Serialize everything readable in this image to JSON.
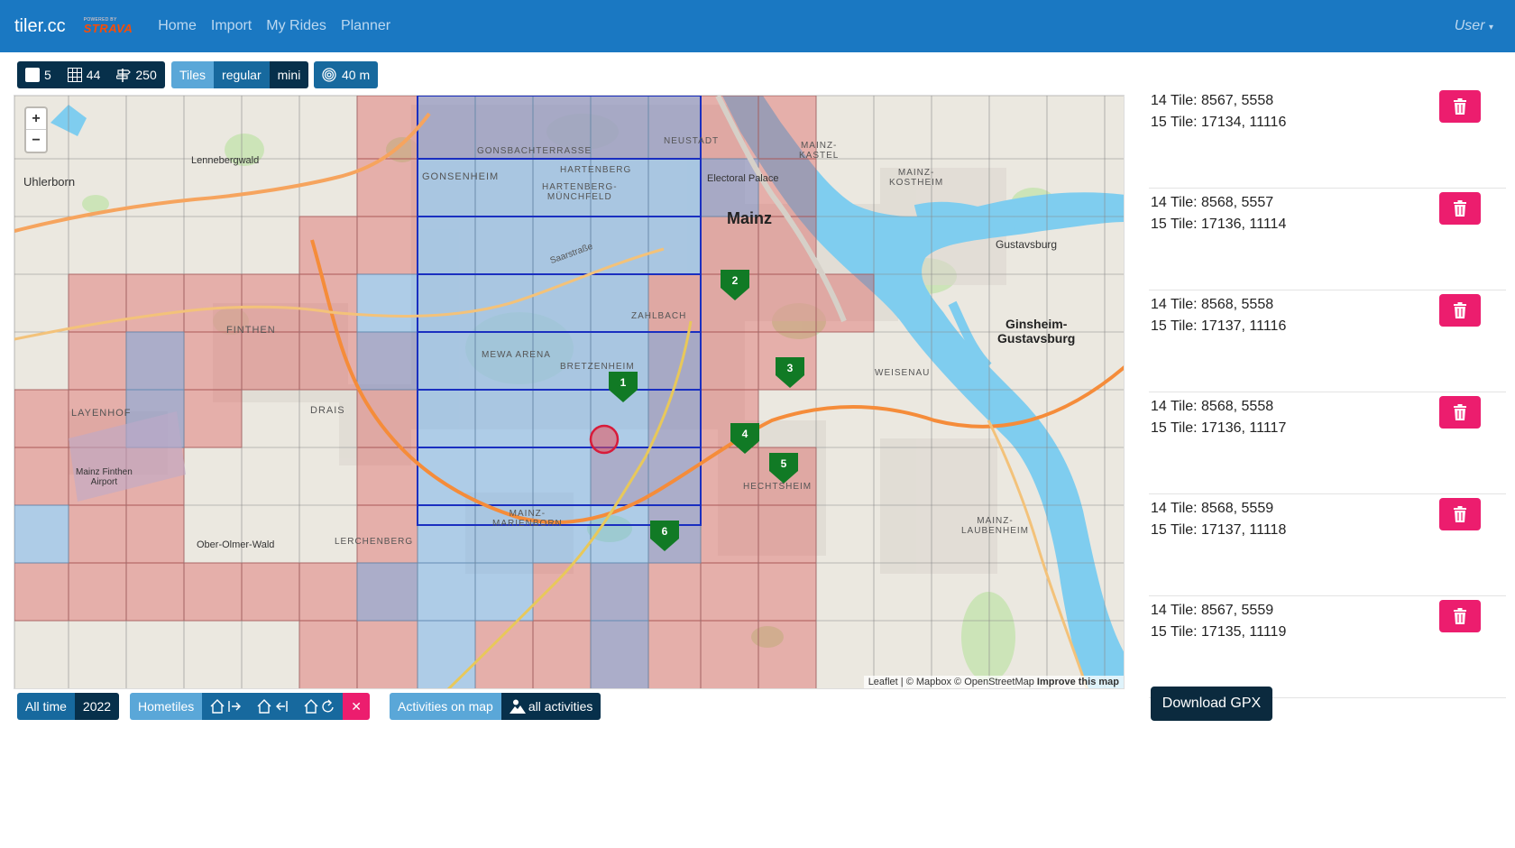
{
  "navbar": {
    "brand": "tiler.cc",
    "strava_small": "POWERED BY",
    "strava_big": "STRAVA",
    "links": [
      "Home",
      "Import",
      "My Rides",
      "Planner"
    ],
    "user": "User"
  },
  "toolbar": {
    "squares": "5",
    "tiles_count": "44",
    "route_count": "250",
    "tiles_label": "Tiles",
    "regular_label": "regular",
    "mini_label": "mini",
    "radius_label": "40 m"
  },
  "map": {
    "labels": {
      "uhlerborn": "Uhlerborn",
      "lennebergwald": "Lennebergwald",
      "gonsbachterrasse": "GONSBACHTERRASSE",
      "gonsenheim": "GONSENHEIM",
      "hartenberg": "HARTENBERG",
      "hartenberg_munchfeld": "HARTENBERG-\nMÜNCHFELD",
      "neustadt": "NEUSTADT",
      "electoral_palace": "Electoral Palace",
      "mainz": "Mainz",
      "mainz_kastel": "MAINZ-\nKASTEL",
      "mainz_kostheim": "MAINZ-\nKOSTHEIM",
      "gustavsburg": "Gustavsburg",
      "saarstrasse": "Saarstraße",
      "finthen": "FINTHEN",
      "mewa_arena": "MEWA ARENA",
      "zahlbach": "ZAHLBACH",
      "bretzenheim": "BRETZENHEIM",
      "ginsheim": "Ginsheim-\nGustavsburg",
      "weisenau": "WEISENAU",
      "layenhof": "LAYENHOF",
      "drais": "DRAIS",
      "airport": "Mainz Finthen\nAirport",
      "hechtsheim": "HECHTSHEIM",
      "mainz_laubenheim": "MAINZ-\nLAUBENHEIM",
      "marienborn": "MAINZ-\nMARIENBORN",
      "ober_olmer_wald": "Ober-Olmer-Wald",
      "lerchenberg": "LERCHENBERG"
    },
    "markers": [
      "1",
      "2",
      "3",
      "4",
      "5",
      "6"
    ],
    "zoom_in": "+",
    "zoom_out": "−",
    "attribution_leaflet": "Leaflet",
    "attribution_rest": " | © Mapbox © OpenStreetMap ",
    "attribution_improve": "Improve this map"
  },
  "bottombar": {
    "all_time": "All time",
    "year": "2022",
    "hometiles": "Hometiles",
    "activities_on_map": "Activities on map",
    "all_activities": "all activities"
  },
  "tiles": [
    {
      "line1": "14 Tile: 8567, 5558",
      "line2": "15 Tile: 17134, 11116"
    },
    {
      "line1": "14 Tile: 8568, 5557",
      "line2": "15 Tile: 17136, 11114"
    },
    {
      "line1": "14 Tile: 8568, 5558",
      "line2": "15 Tile: 17137, 11116"
    },
    {
      "line1": "14 Tile: 8568, 5558",
      "line2": "15 Tile: 17136, 11117"
    },
    {
      "line1": "14 Tile: 8568, 5559",
      "line2": "15 Tile: 17137, 11118"
    },
    {
      "line1": "14 Tile: 8567, 5559",
      "line2": "15 Tile: 17135, 11119"
    }
  ],
  "download_label": "Download GPX"
}
